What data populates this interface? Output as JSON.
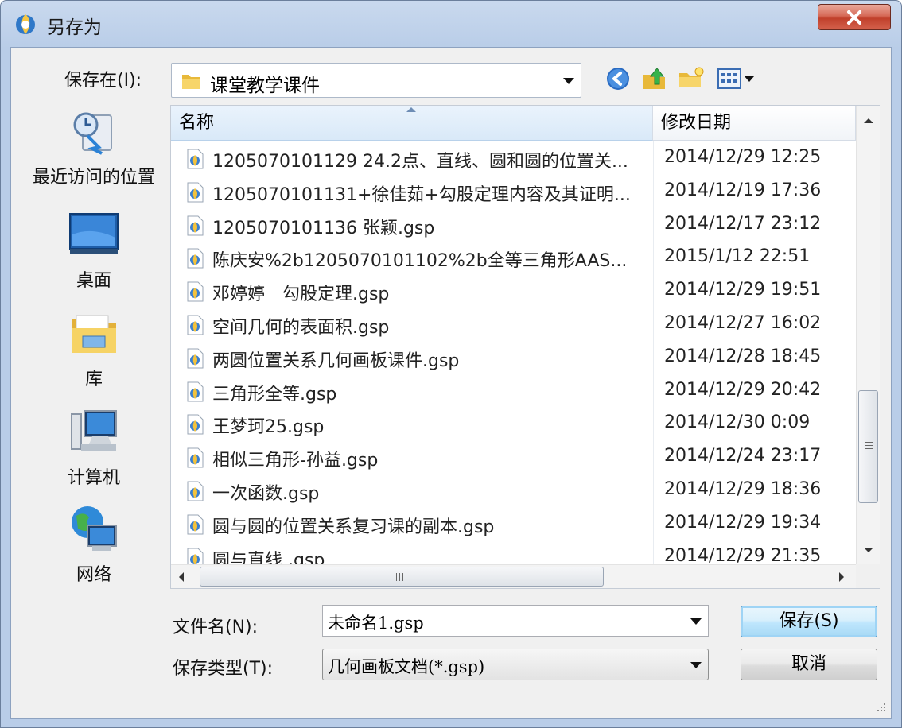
{
  "window": {
    "title": "另存为"
  },
  "toolbar": {
    "save_in_label": "保存在(I):",
    "save_in_value": "课堂教学课件"
  },
  "places": [
    {
      "label": "最近访问的位置",
      "icon": "recent-places-icon"
    },
    {
      "label": "桌面",
      "icon": "desktop-icon"
    },
    {
      "label": "库",
      "icon": "libraries-icon"
    },
    {
      "label": "计算机",
      "icon": "computer-icon"
    },
    {
      "label": "网络",
      "icon": "network-icon"
    }
  ],
  "filelist": {
    "columns": [
      "名称",
      "修改日期"
    ],
    "rows": [
      {
        "name": "1205070101129 24.2点、直线、圆和圆的位置关...",
        "date": "2014/12/29 12:25"
      },
      {
        "name": "1205070101131+徐佳茹+勾股定理内容及其证明...",
        "date": "2014/12/19 17:36"
      },
      {
        "name": "1205070101136 张颖.gsp",
        "date": "2014/12/17 23:12"
      },
      {
        "name": "陈庆安%2b1205070101102%2b全等三角形AAS...",
        "date": "2015/1/12 22:51"
      },
      {
        "name": "邓婷婷　勾股定理.gsp",
        "date": "2014/12/29 19:51"
      },
      {
        "name": "空间几何的表面积.gsp",
        "date": "2014/12/27 16:02"
      },
      {
        "name": "两圆位置关系几何画板课件.gsp",
        "date": "2014/12/28 18:45"
      },
      {
        "name": "三角形全等.gsp",
        "date": "2014/12/29 20:42"
      },
      {
        "name": "王梦珂25.gsp",
        "date": "2014/12/30 0:09"
      },
      {
        "name": "相似三角形-孙益.gsp",
        "date": "2014/12/24 23:17"
      },
      {
        "name": "一次函数.gsp",
        "date": "2014/12/29 18:36"
      },
      {
        "name": "圆与圆的位置关系复习课的副本.gsp",
        "date": "2014/12/29 19:34"
      },
      {
        "name": "圆与直线 .gsp",
        "date": "2014/12/29 21:35"
      }
    ]
  },
  "form": {
    "filename_label": "文件名(N):",
    "filename_value": "未命名1.gsp",
    "filetype_label": "保存类型(T):",
    "filetype_value": "几何画板文档(*.gsp)",
    "save_button": "保存(S)",
    "cancel_button": "取消"
  },
  "colors": {
    "title_bar": "#c9d9ee",
    "close_button": "#c0402b",
    "default_button": "#bee6fd"
  }
}
